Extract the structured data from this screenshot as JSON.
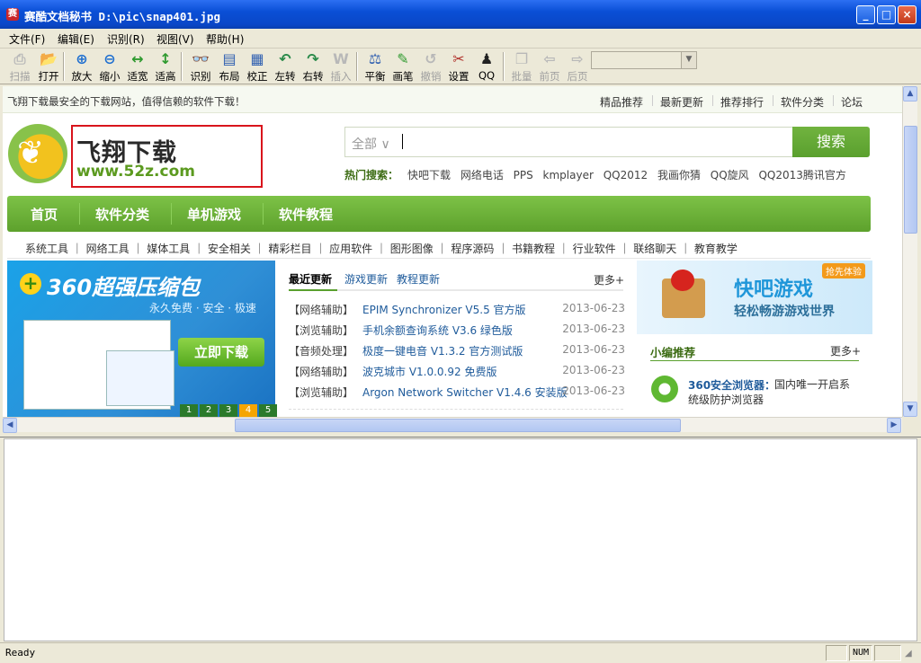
{
  "window": {
    "title": "赛酷文档秘书 D:\\pic\\snap401.jpg",
    "icon_label": "赛",
    "minimize": "_",
    "maximize": "□",
    "close": "×"
  },
  "menu": [
    "文件(F)",
    "编辑(E)",
    "识别(R)",
    "视图(V)",
    "帮助(H)"
  ],
  "toolbar": [
    {
      "label": "扫描",
      "icon": "scanner-icon",
      "glyph": "⎙",
      "enabled": false
    },
    {
      "label": "打开",
      "icon": "folder-open-icon",
      "glyph": "📂",
      "enabled": true
    },
    {
      "label": "放大",
      "icon": "zoom-in-icon",
      "glyph": "⊕",
      "enabled": true
    },
    {
      "label": "缩小",
      "icon": "zoom-out-icon",
      "glyph": "⊖",
      "enabled": true
    },
    {
      "label": "适宽",
      "icon": "fit-width-icon",
      "glyph": "↔",
      "enabled": true
    },
    {
      "label": "适高",
      "icon": "fit-height-icon",
      "glyph": "↕",
      "enabled": true
    },
    {
      "label": "识别",
      "icon": "recognize-icon",
      "glyph": "👓",
      "enabled": true
    },
    {
      "label": "布局",
      "icon": "layout-icon",
      "glyph": "▤",
      "enabled": true
    },
    {
      "label": "校正",
      "icon": "correct-icon",
      "glyph": "▦",
      "enabled": true
    },
    {
      "label": "左转",
      "icon": "rotate-left-icon",
      "glyph": "↶",
      "enabled": true
    },
    {
      "label": "右转",
      "icon": "rotate-right-icon",
      "glyph": "↷",
      "enabled": true
    },
    {
      "label": "插入",
      "icon": "insert-word-icon",
      "glyph": "W",
      "enabled": false
    },
    {
      "label": "平衡",
      "icon": "balance-icon",
      "glyph": "⚖",
      "enabled": true
    },
    {
      "label": "画笔",
      "icon": "pen-icon",
      "glyph": "✎",
      "enabled": true
    },
    {
      "label": "撤销",
      "icon": "undo-icon",
      "glyph": "↺",
      "enabled": false
    },
    {
      "label": "设置",
      "icon": "settings-tools-icon",
      "glyph": "✂",
      "enabled": true
    },
    {
      "label": "QQ",
      "icon": "qq-penguin-icon",
      "glyph": "♟",
      "enabled": true
    },
    {
      "label": "批量",
      "icon": "batch-icon",
      "glyph": "❐",
      "enabled": false
    },
    {
      "label": "前页",
      "icon": "prev-page-icon",
      "glyph": "⇦",
      "enabled": false
    },
    {
      "label": "后页",
      "icon": "next-page-icon",
      "glyph": "⇨",
      "enabled": false
    }
  ],
  "site": {
    "slogan": "飞翔下载最安全的下载网站，值得信赖的软件下载！",
    "top_links": [
      "精品推荐",
      "最新更新",
      "推荐排行",
      "软件分类",
      "论坛"
    ],
    "logo_cn": "飞翔下载",
    "logo_url": "www.52z.com",
    "search_scope": "全部 ∨",
    "search_button": "搜索",
    "hot_label": "热门搜索：",
    "hot_items": "快吧下载 网络电话 PPS kmplayer QQ2012 我画你猜 QQ旋风 QQ2013腾讯官方",
    "nav": [
      "首页",
      "软件分类",
      "单机游戏",
      "软件教程"
    ],
    "subnav": "系统工具 ｜ 网络工具 ｜ 媒体工具 ｜ 安全相关 ｜ 精彩栏目 ｜ 应用软件 ｜ 图形图像 ｜ 程序源码 ｜ 书籍教程 ｜ 行业软件 ｜ 联络聊天 ｜ 教育教学",
    "banner_title": "360超强压缩包",
    "banner_sub": "永久免费 · 安全 · 极速",
    "banner_button": "立即下载",
    "banner_pages": [
      "1",
      "2",
      "3",
      "4",
      "5"
    ],
    "banner_active_page": "4",
    "tabs": [
      "最近更新",
      "游戏更新",
      "教程更新"
    ],
    "more": "更多+",
    "news": [
      {
        "cat": "【网络辅助】",
        "title": "EPIM Synchronizer V5.5 官方版",
        "date": "2013-06-23"
      },
      {
        "cat": "【浏览辅助】",
        "title": "手机余额查询系统 V3.6 绿色版",
        "date": "2013-06-23"
      },
      {
        "cat": "【音频处理】",
        "title": "极度一键电音 V1.3.2 官方测试版",
        "date": "2013-06-23"
      },
      {
        "cat": "【网络辅助】",
        "title": "波克城市 V1.0.0.92 免费版",
        "date": "2013-06-23"
      },
      {
        "cat": "【浏览辅助】",
        "title": "Argon Network Switcher V1.4.6 安装版",
        "date": "2013-06-23"
      }
    ],
    "game_title": "快吧游戏",
    "game_sub": "轻松畅游游戏世界",
    "game_badge": "抢先体验",
    "rec_title": "小编推荐",
    "rec_more": "更多+",
    "rec_name": "360安全浏览器：",
    "rec_desc": "国内唯一开启系统级防护浏览器"
  },
  "status": {
    "text": "Ready",
    "num": "NUM"
  }
}
